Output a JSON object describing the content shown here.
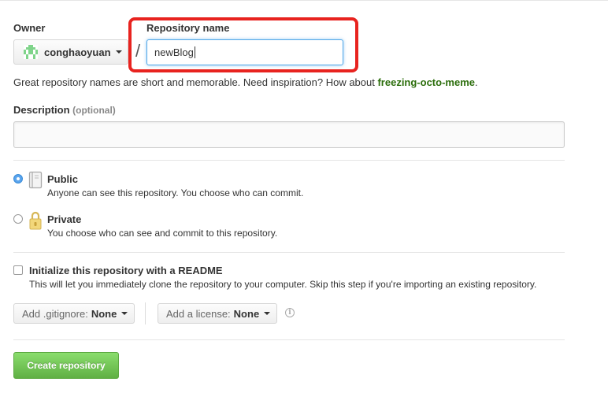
{
  "owner": {
    "label": "Owner",
    "name": "conghaoyuan"
  },
  "separator": "/",
  "repo": {
    "label": "Repository name",
    "value": "newBlog"
  },
  "hint": {
    "text": "Great repository names are short and memorable. Need inspiration? How about ",
    "suggestion": "freezing-octo-meme",
    "end": "."
  },
  "description": {
    "label": "Description",
    "optional": "(optional)",
    "value": ""
  },
  "visibility": {
    "public": {
      "title": "Public",
      "desc": "Anyone can see this repository. You choose who can commit.",
      "selected": true
    },
    "private": {
      "title": "Private",
      "desc": "You choose who can see and commit to this repository.",
      "selected": false
    }
  },
  "readme": {
    "title": "Initialize this repository with a README",
    "desc": "This will let you immediately clone the repository to your computer. Skip this step if you're importing an existing repository.",
    "checked": false
  },
  "gitignore": {
    "label": "Add .gitignore:",
    "value": "None"
  },
  "license": {
    "label": "Add a license:",
    "value": "None"
  },
  "create_button": "Create repository",
  "colors": {
    "highlight": "#e8231f",
    "suggestion": "#2c6e0c",
    "create_btn": "#6cc644",
    "radio_selected": "#3d8ed9"
  }
}
